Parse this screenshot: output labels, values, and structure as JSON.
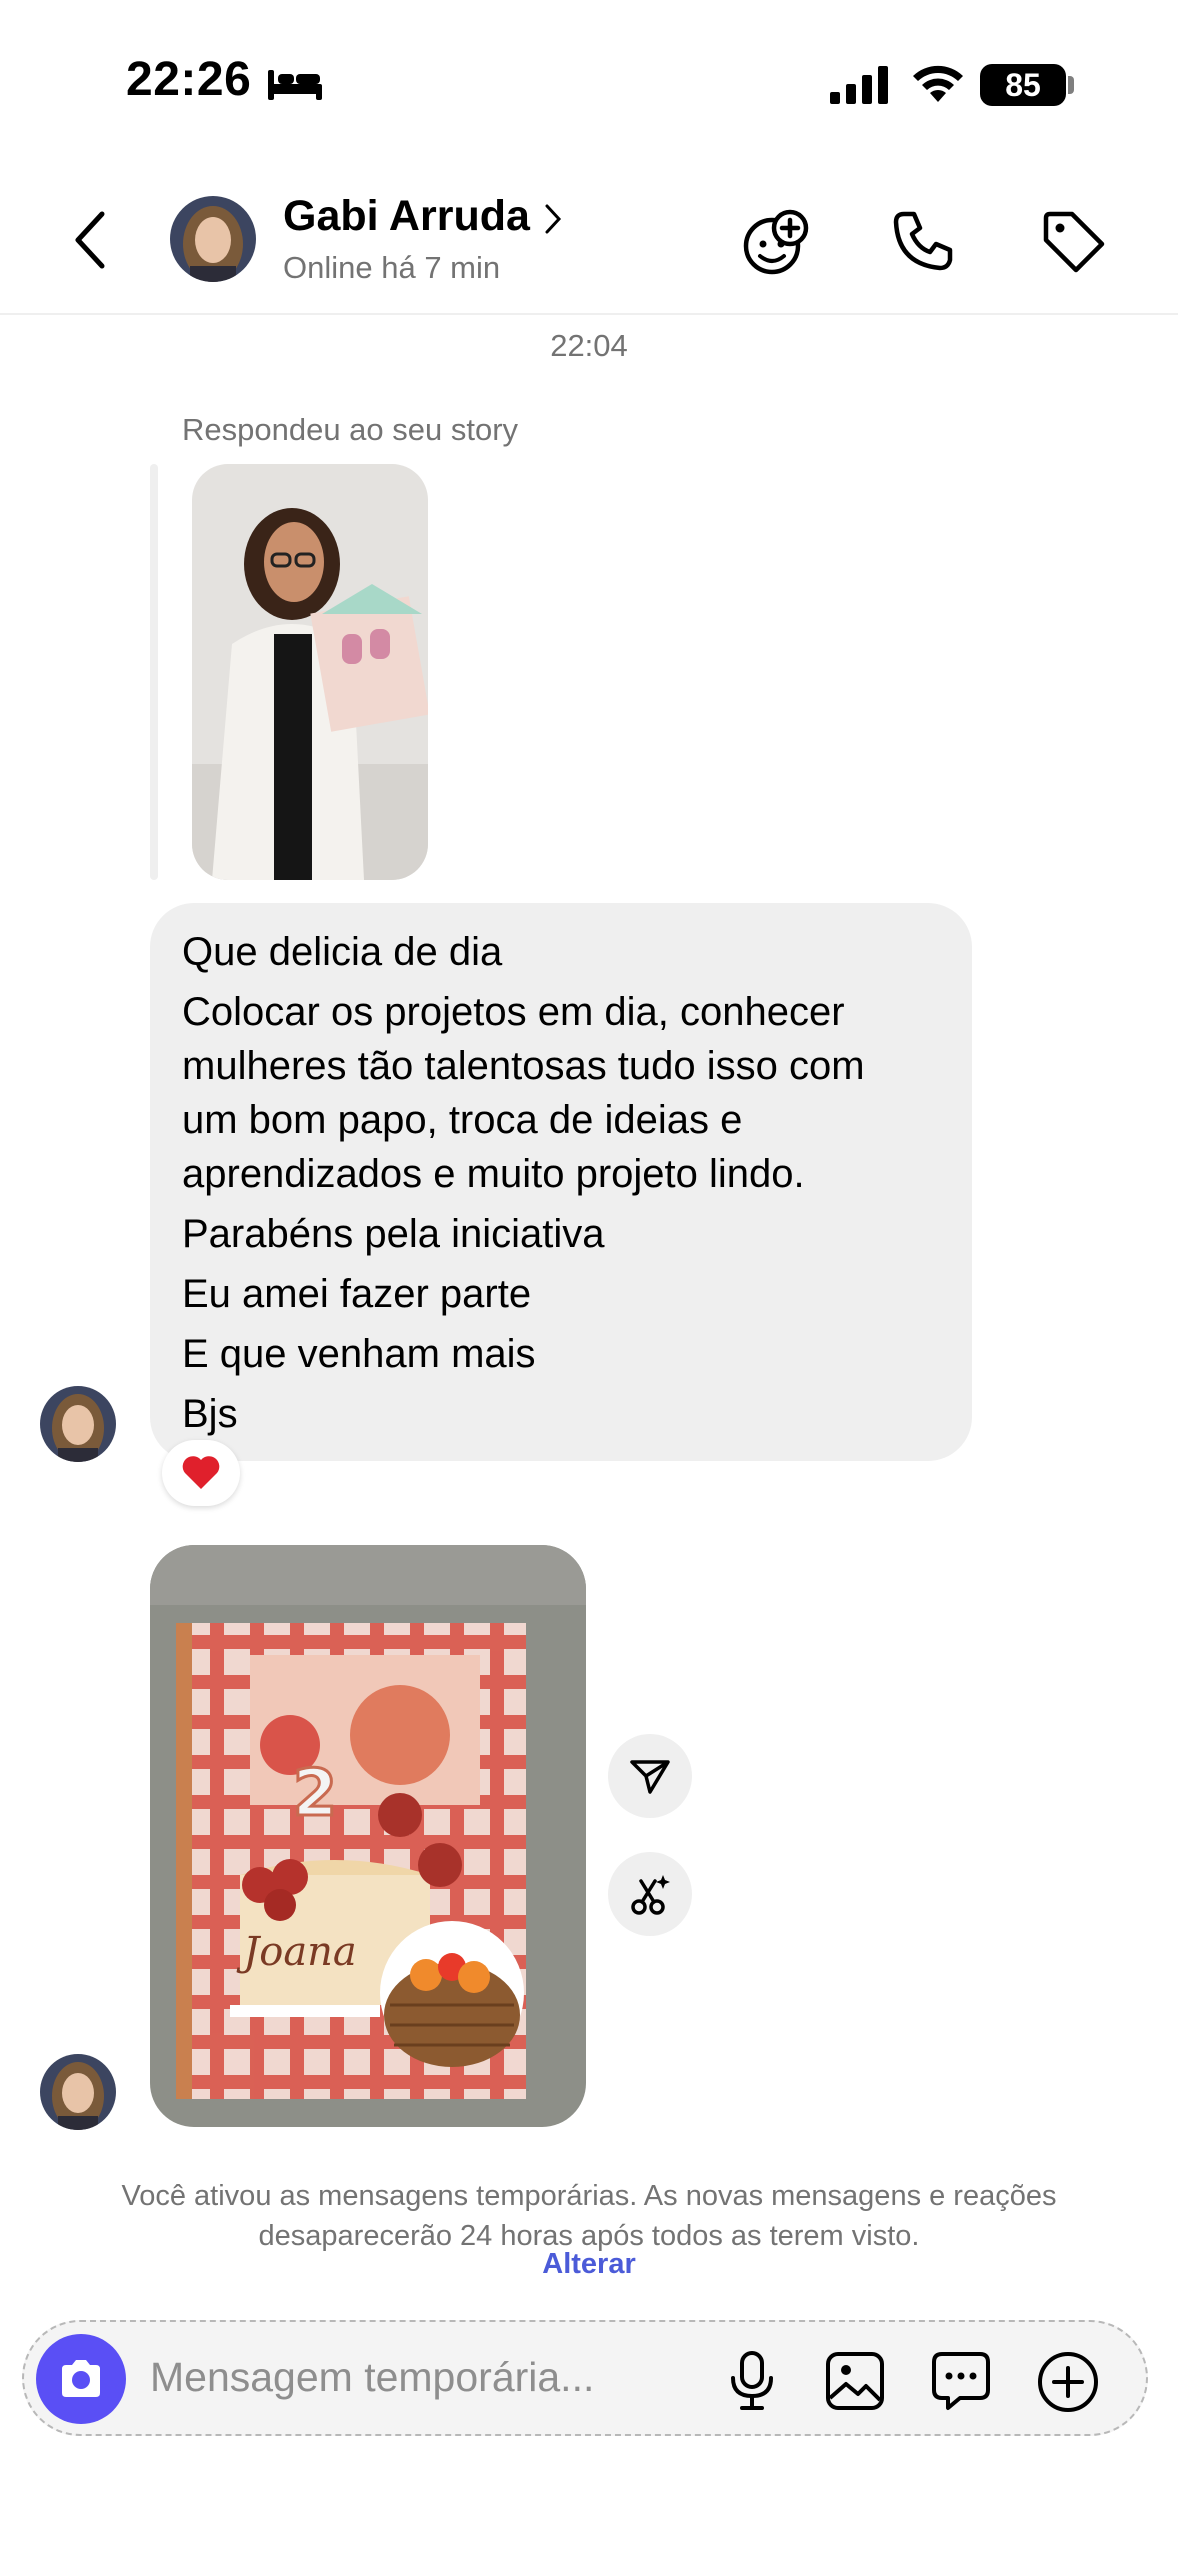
{
  "status_bar": {
    "time": "22:26",
    "battery": "85"
  },
  "header": {
    "name": "Gabi Arruda",
    "presence": "Online há 7 min"
  },
  "chat": {
    "timestamp": "22:04",
    "reply_label": "Respondeu ao seu story",
    "message_lines": [
      "Que delicia de dia",
      "Colocar os projetos em dia, conhecer",
      "mulheres tão talentosas tudo isso com",
      "um bom papo, troca de ideias e",
      "aprendizados e muito projeto lindo.",
      "Parabéns pela iniciativa",
      "Eu amei fazer parte",
      "E que venham mais",
      "Bjs"
    ],
    "reaction": "❤️"
  },
  "photo": {
    "caption_text": "Joana",
    "number": "2"
  },
  "notice": {
    "text": "Você ativou as mensagens temporárias. As novas mensagens e reações desaparecerão 24 horas após todos as terem visto.",
    "link": "Alterar"
  },
  "composer": {
    "placeholder": "Mensagem temporária..."
  },
  "colors": {
    "accent": "#5a4ff5",
    "link": "#4b5bd8",
    "bubble": "#efefef",
    "muted": "#737373"
  },
  "icons": [
    "bed-icon",
    "signal-icon",
    "wifi-icon",
    "back-icon",
    "chevron-right-icon",
    "add-effect-icon",
    "phone-icon",
    "tag-icon",
    "heart-icon",
    "send-icon",
    "magic-scissors-icon",
    "camera-icon",
    "microphone-icon",
    "gallery-icon",
    "sticker-chat-icon",
    "plus-circle-icon"
  ]
}
